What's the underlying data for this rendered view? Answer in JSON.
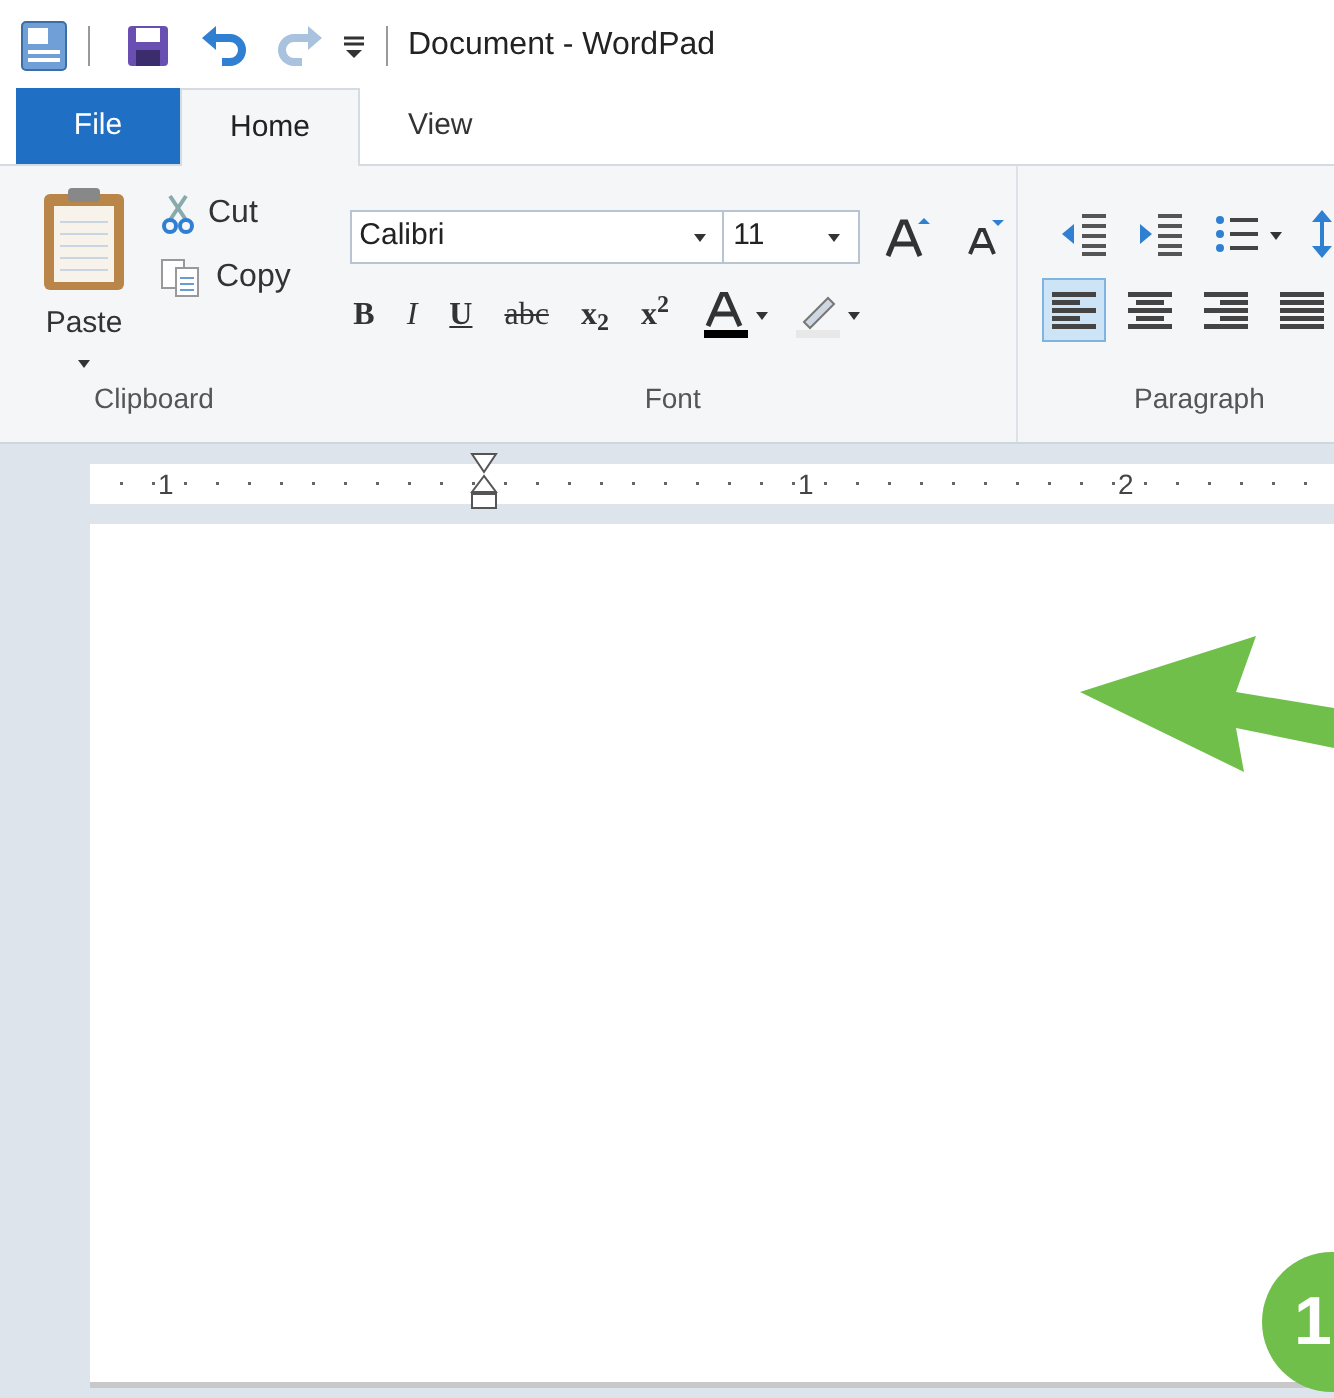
{
  "window": {
    "title": "Document - WordPad"
  },
  "tabs": [
    {
      "label": "File",
      "kind": "file",
      "selected": false
    },
    {
      "label": "Home",
      "kind": "tab",
      "selected": true
    },
    {
      "label": "View",
      "kind": "tab",
      "selected": false
    }
  ],
  "clipboard": {
    "paste": "Paste",
    "cut": "Cut",
    "copy": "Copy",
    "group_label": "Clipboard"
  },
  "font": {
    "name": "Calibri",
    "size": "11",
    "group_label": "Font",
    "formats": [
      {
        "kind": "bold",
        "label": "B"
      },
      {
        "kind": "italic",
        "label": "I"
      },
      {
        "kind": "underline",
        "label": "U"
      },
      {
        "kind": "strike",
        "label": "abc"
      },
      {
        "kind": "sub",
        "label": "x$_{2}$"
      },
      {
        "kind": "sup",
        "label": "x$^{2}$"
      }
    ]
  },
  "paragraph": {
    "group_label": "Paragraph",
    "alignments": [
      {
        "kind": "left",
        "selected": true
      },
      {
        "kind": "center",
        "selected": false
      },
      {
        "kind": "right",
        "selected": false
      },
      {
        "kind": "justify",
        "selected": false
      }
    ]
  },
  "ruler": {
    "labels": [
      "1",
      "1",
      "2"
    ]
  },
  "callout": {
    "number": "1"
  }
}
